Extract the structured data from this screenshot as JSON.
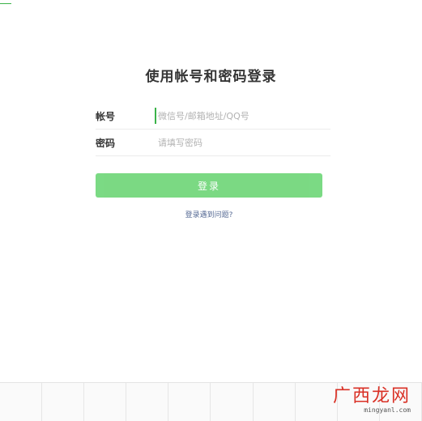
{
  "login": {
    "title": "使用帐号和密码登录",
    "account": {
      "label": "帐号",
      "value": "",
      "placeholder": "微信号/邮箱地址/QQ号"
    },
    "password": {
      "label": "密码",
      "value": "",
      "placeholder": "请填写密码"
    },
    "submit_label": "登录",
    "help_link": "登录遇到问题?"
  },
  "watermark": {
    "brand": "广西龙网",
    "domain": "mingyanl.com"
  },
  "colors": {
    "accent": "#3bb34a",
    "button": "#74d87d",
    "link": "#576b95",
    "watermark": "#d93025"
  }
}
